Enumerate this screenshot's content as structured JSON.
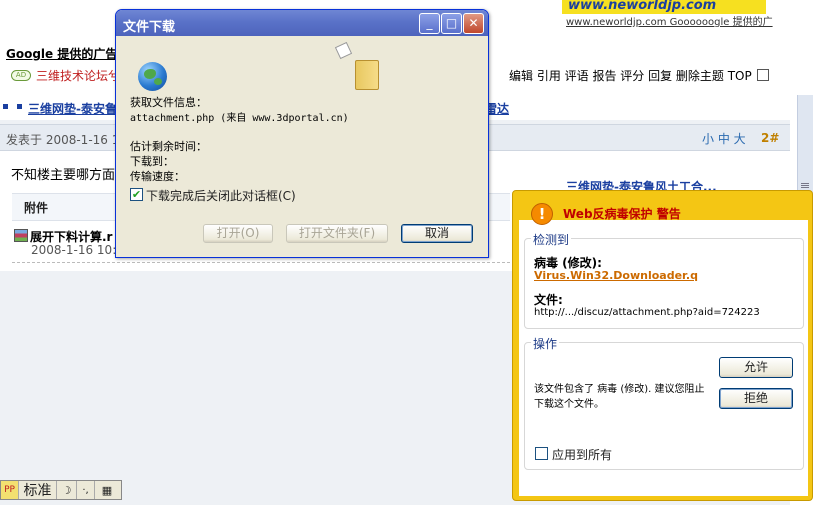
{
  "forum": {
    "ad_banner_text": "www.neworldjp.com",
    "ad_banner_sub": "www.neworldjp.com Goooooogle 提供的广",
    "google_ads_title": "Google 提供的广告",
    "ad_badge": "AD",
    "ad_link": "三维技术论坛兮",
    "topic_tools": "编辑 引用 评语 报告 评分 回复 删除主题 TOP",
    "thread_link_left": "三维网垫-泰安鲁",
    "thread_link_right": "雷达",
    "post_date": "发表于 2008-1-16 10",
    "font_size_controls": "小 中 大",
    "floor_number": "2#",
    "post_text": "不知楼主要哪方面",
    "signature_link": "三维网垫-泰安鲁风土工合...",
    "attachment_heading": "附件",
    "attachment_name": "展开下料计算.r",
    "attachment_date": "2008-1-16 10:1"
  },
  "ime_bar": {
    "logo": "PP",
    "mode": "标准",
    "moon": "☽",
    "punct": "·,",
    "keyboard": "▦"
  },
  "download_dialog": {
    "title": "文件下载",
    "window_buttons": {
      "minimize": "_",
      "maximize": "□",
      "close": "✕"
    },
    "getting_info_label": "获取文件信息：",
    "file_source": "attachment.php (来自 www.3dportal.cn)",
    "time_left_label": "估计剩余时间：",
    "download_to_label": "下载到：",
    "transfer_rate_label": "传输速度：",
    "close_on_complete_label": "下载完成后关闭此对话框(C)",
    "close_on_complete_checked": true,
    "open_button": "打开(O)",
    "open_folder_button": "打开文件夹(F)",
    "cancel_button": "取消"
  },
  "antivirus_popup": {
    "title": "Web反病毒保护 警告",
    "detected_group": "检测到",
    "virus_label": "病毒 (修改):",
    "virus_name": "Virus.Win32.Downloader.q",
    "file_label": "文件:",
    "file_path": "http://.../discuz/attachment.php?aid=724223",
    "actions_group": "操作",
    "allow_button": "允许",
    "deny_button": "拒绝",
    "message": "该文件包含了 病毒 (修改). 建议您阻止下载这个文件。",
    "apply_all_label": "应用到所有",
    "apply_all_checked": false,
    "accent_color": "#f4c614"
  }
}
